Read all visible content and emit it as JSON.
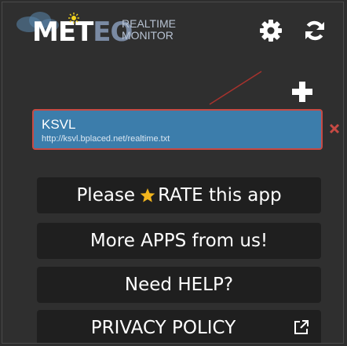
{
  "header": {
    "logo_word_1": "M",
    "logo_word_2": "E",
    "logo_word_3": "T",
    "logo_word_4": "E",
    "logo_word_5": "O",
    "logo_subtitle": "REALTIME\nMONITOR",
    "icons": [
      "gear-icon",
      "sync-icon",
      "sun-icon",
      "cloud-icon"
    ]
  },
  "toolbar": {
    "add_icon": "plus-icon"
  },
  "station": {
    "name": "KSVL",
    "url": "http://ksvl.bplaced.net/realtime.txt",
    "remove_icon": "x-icon"
  },
  "menu": {
    "rate_before": "Please",
    "rate_after": "RATE this app",
    "more_apps": "More APPS from us!",
    "help": "Need HELP?",
    "privacy": "PRIVACY POLICY",
    "privacy_icon": "external-link-icon"
  },
  "colors": {
    "background": "#2f2f2f",
    "button_bg": "#1f1f1f",
    "station_bg": "#3c7dab",
    "selection_border": "#c74a44",
    "star": "#f2b51d"
  }
}
